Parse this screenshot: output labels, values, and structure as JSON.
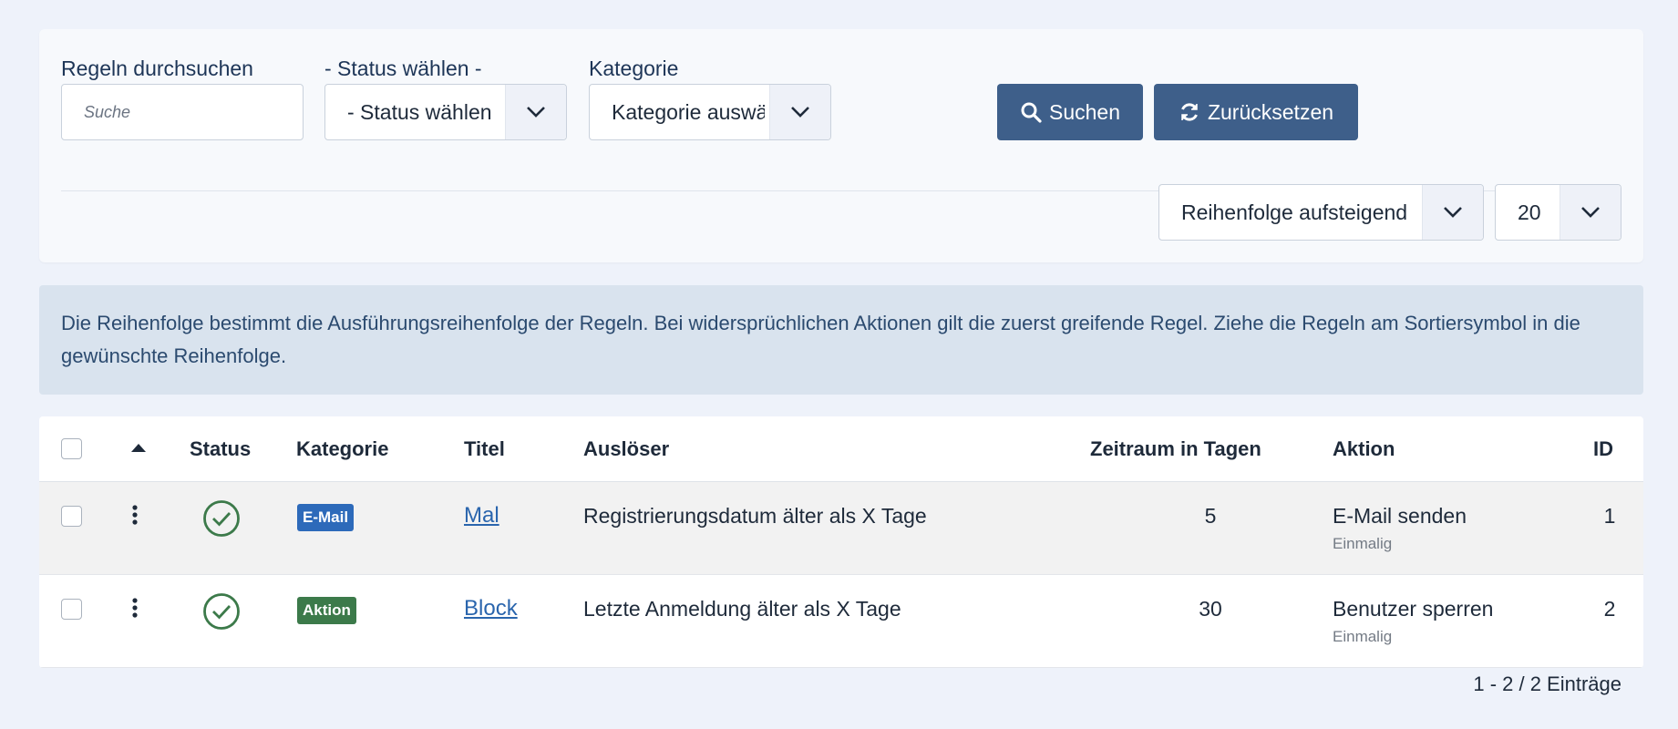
{
  "filters": {
    "search": {
      "label": "Regeln durchsuchen",
      "placeholder": "Suche"
    },
    "status": {
      "label": "- Status wählen -",
      "selected": "- Status wählen"
    },
    "category": {
      "label": "Kategorie",
      "selected": "Kategorie auswählen"
    },
    "search_button": "Suchen",
    "reset_button": "Zurücksetzen",
    "ordering": "Reihenfolge aufsteigend",
    "limit": "20"
  },
  "info_text": "Die Reihenfolge bestimmt die Ausführungsreihenfolge der Regeln. Bei widersprüchlichen Aktionen gilt die zuerst greifende Regel. Ziehe die Regeln am Sortiersymbol in die gewünschte Reihenfolge.",
  "table": {
    "headers": {
      "status": "Status",
      "category": "Kategorie",
      "title": "Titel",
      "trigger": "Auslöser",
      "period": "Zeitraum in Tagen",
      "action": "Aktion",
      "id": "ID"
    },
    "rows": [
      {
        "category": "E-Mail",
        "category_color": "#2d6aba",
        "title": "Mal",
        "trigger": "Registrierungsdatum älter als X Tage",
        "period": "5",
        "action": "E-Mail senden",
        "action_sub": "Einmalig",
        "id": "1"
      },
      {
        "category": "Aktion",
        "category_color": "#3c7a4a",
        "title": "Block",
        "trigger": "Letzte Anmeldung älter als X Tage",
        "period": "30",
        "action": "Benutzer sperren",
        "action_sub": "Einmalig",
        "id": "2"
      }
    ]
  },
  "pagination_info": "1 - 2 / 2 Einträge",
  "colors": {
    "primary_button": "#3e5f8a",
    "status_ok": "#3c7a4a",
    "link": "#2a65ad"
  }
}
